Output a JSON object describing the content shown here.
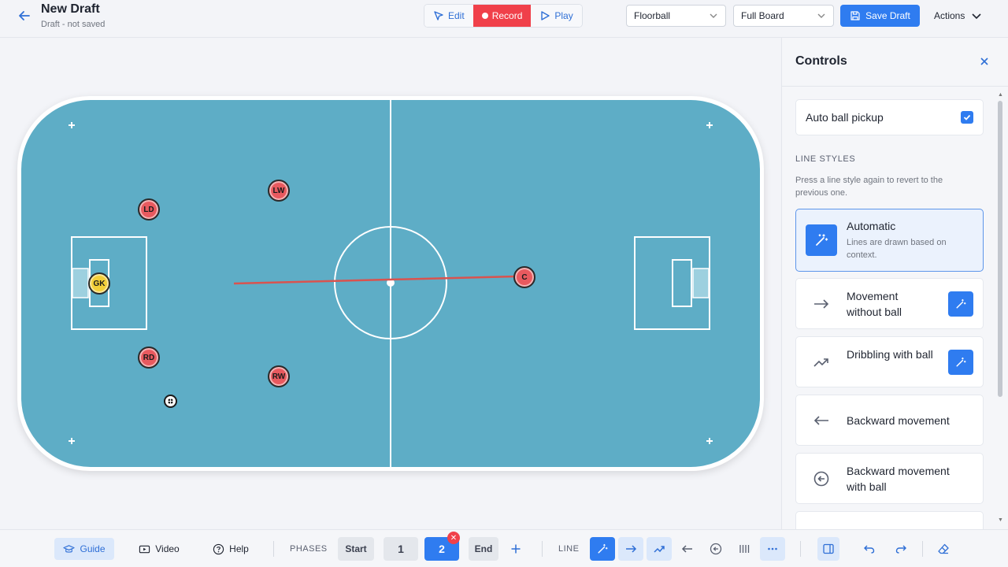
{
  "header": {
    "title": "New Draft",
    "subtitle": "Draft - not saved",
    "modes": {
      "edit": "Edit",
      "record": "Record",
      "play": "Play"
    },
    "sport_select": "Floorball",
    "board_select": "Full Board",
    "save_label": "Save Draft",
    "actions_label": "Actions"
  },
  "board": {
    "players": [
      {
        "label": "LW"
      },
      {
        "label": "LD"
      },
      {
        "label": "GK"
      },
      {
        "label": "RD"
      },
      {
        "label": "RW"
      },
      {
        "label": "C"
      }
    ],
    "colors": {
      "surface": "#5eadc6",
      "lines": "#ffffff",
      "movement_line": "#d9534f",
      "player_red": "#e85a5f",
      "goalkeeper_yellow": "#f3cf3a"
    }
  },
  "panel": {
    "title": "Controls",
    "auto_pickup": {
      "label": "Auto ball pickup",
      "checked": true
    },
    "section_label": "LINE STYLES",
    "section_hint": "Press a line style again to revert to the previous one.",
    "styles": [
      {
        "label": "Automatic",
        "desc": "Lines are drawn based on context.",
        "icon": "magic-wand-icon"
      },
      {
        "label": "Movement without ball",
        "icon": "arrow-right-icon"
      },
      {
        "label": "Dribbling with ball",
        "icon": "trend-up-icon"
      },
      {
        "label": "Backward movement",
        "icon": "arrow-left-icon"
      },
      {
        "label": "Backward movement with ball",
        "icon": "circle-arrow-left-icon"
      }
    ]
  },
  "footer": {
    "guide": "Guide",
    "video": "Video",
    "help": "Help",
    "phases_label": "PHASES",
    "phase_start": "Start",
    "phase_1": "1",
    "phase_2": "2",
    "phase_end": "End",
    "line_label": "LINE"
  }
}
